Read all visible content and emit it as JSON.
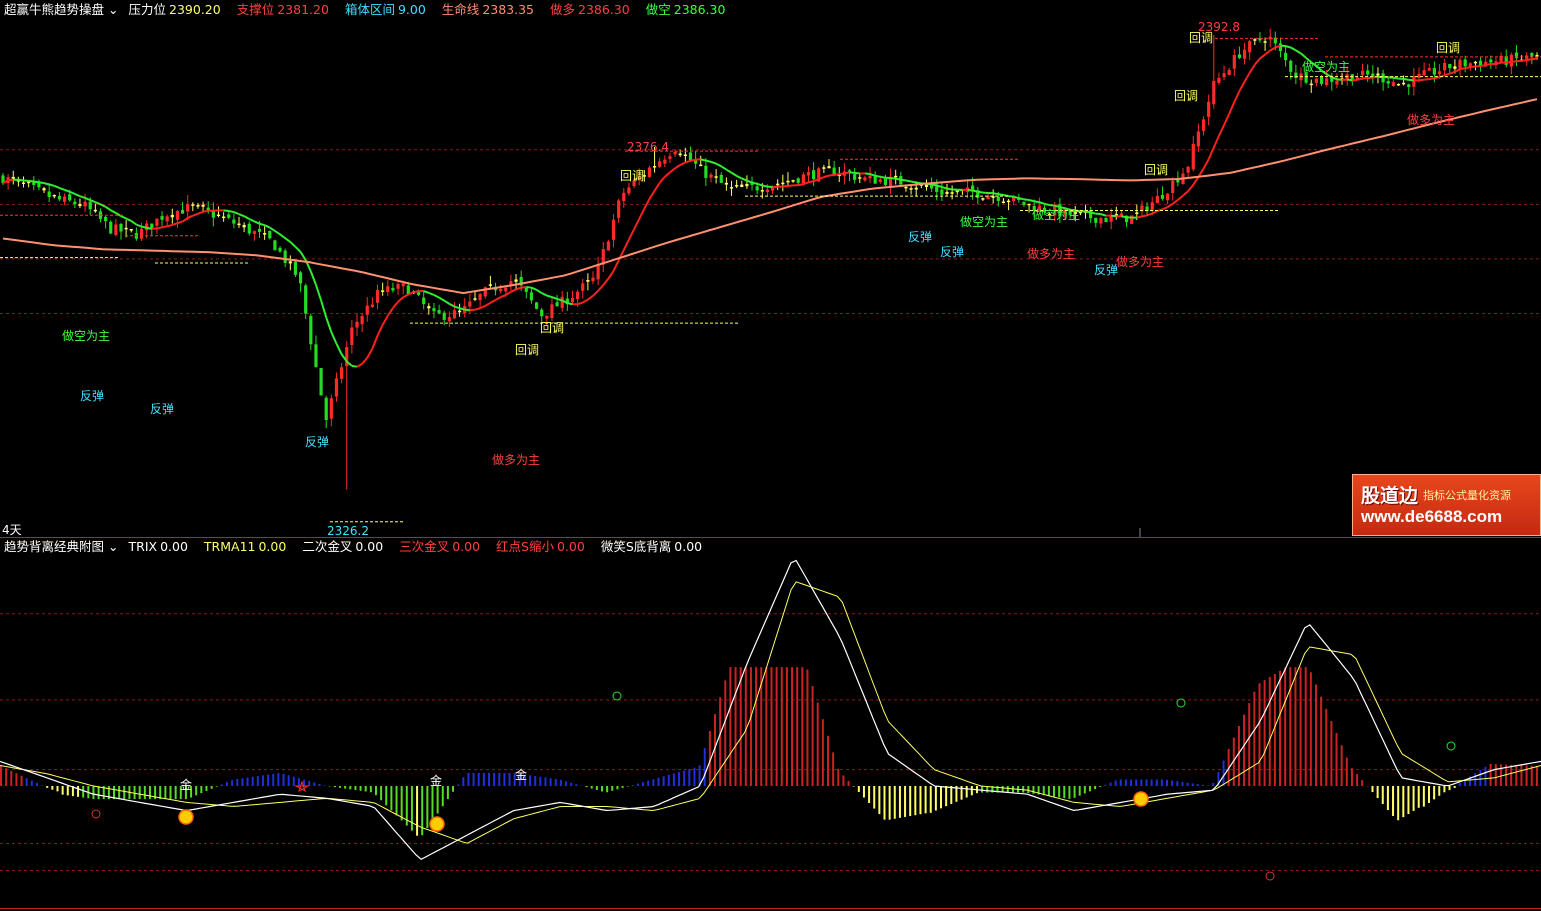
{
  "main_header": {
    "title": "超赢牛熊趋势操盘",
    "items": [
      {
        "label": "压力位",
        "value": "2390.20",
        "color": "#ffffff",
        "vcolor": "#ffff66"
      },
      {
        "label": "支撑位",
        "value": "2381.20",
        "color": "#ff4040",
        "vcolor": "#ff4040"
      },
      {
        "label": "箱体区间",
        "value": "9.00",
        "color": "#40e0ff",
        "vcolor": "#40e0ff"
      },
      {
        "label": "生命线",
        "value": "2383.35",
        "color": "#ff9070",
        "vcolor": "#ff9070"
      },
      {
        "label": "做多",
        "value": "2386.30",
        "color": "#ff4040",
        "vcolor": "#ff4040"
      },
      {
        "label": "做空",
        "value": "2386.30",
        "color": "#40ff40",
        "vcolor": "#40ff40"
      }
    ]
  },
  "sub_header": {
    "title": "趋势背离经典附图",
    "items": [
      {
        "label": "TRIX",
        "value": "0.00",
        "color": "#ffffff"
      },
      {
        "label": "TRMA11",
        "value": "0.00",
        "color": "#ffff66"
      },
      {
        "label": "二次金叉",
        "value": "0.00",
        "color": "#ffffff"
      },
      {
        "label": "三次金叉",
        "value": "0.00",
        "color": "#ff4040"
      },
      {
        "label": "红点S缩小",
        "value": "0.00",
        "color": "#ff4040"
      },
      {
        "label": "微笑S底背离",
        "value": "0.00",
        "color": "#ffffff"
      }
    ]
  },
  "period_label": "4天",
  "price_labels": {
    "high1": "2376.4",
    "high2": "2392.8",
    "low1": "2326.2"
  },
  "annotations": {
    "pullback": "回调",
    "rebound": "反弹",
    "short_main": "做空为主",
    "long_main": "做多为主",
    "gold": "金"
  },
  "watermark": {
    "name": "股道边",
    "tagline": "指标公式量化资源",
    "url": "www.de6688.com"
  },
  "colors": {
    "up": "#ff2a2a",
    "down": "#22dd22",
    "ma_short_up": "#ff2020",
    "ma_short_down": "#30ee30",
    "life_line": "#ff9070",
    "trix": "#ffffff",
    "trma": "#ffff66"
  },
  "chart_data": [
    {
      "type": "line",
      "title": "超赢牛熊趋势操盘",
      "ylim": [
        2320,
        2395
      ],
      "series": [
        {
          "name": "收盘",
          "values": [
            2371.9,
            2370.4,
            2368.7,
            2367.9,
            2364.4,
            2363.6,
            2366.5,
            2367.6,
            2366.3,
            2364.5,
            2362.5,
            2357.1,
            2336.4,
            2350.1,
            2355.2,
            2355.9,
            2351.6,
            2352.1,
            2355.4,
            2357.0,
            2351.8,
            2354.2,
            2357.2,
            2369.5,
            2373.2,
            2376.4,
            2372.8,
            2370.2,
            2370.5,
            2371.3,
            2372.4,
            2372.9,
            2371.7,
            2371.5,
            2370.8,
            2369.7,
            2369.8,
            2369.2,
            2368.0,
            2367.0,
            2366.3,
            2365.9,
            2366.1,
            2369.2,
            2373.4,
            2385.6,
            2390.4,
            2392.8,
            2387.0,
            2386.1,
            2386.8,
            2386.9,
            2385.5,
            2387.2,
            2388.5,
            2388.8,
            2389.1,
            2389.6
          ]
        },
        {
          "name": "生命线",
          "values": [
            2363.0,
            2362.0,
            2361.4,
            2361.2,
            2361.0,
            2360.5,
            2359.5,
            2358.1,
            2356.3,
            2355.0,
            2356.2,
            2357.6,
            2360.0,
            2362.4,
            2364.6,
            2366.8,
            2369.1,
            2370.3,
            2371.0,
            2371.6,
            2371.8,
            2371.7,
            2371.5,
            2371.7,
            2372.6,
            2374.3,
            2376.2,
            2378.0,
            2379.9,
            2381.7,
            2383.4
          ]
        }
      ],
      "markers": {
        "resistance": 2390.2,
        "support": 2381.2
      }
    },
    {
      "type": "line",
      "title": "趋势背离经典附图",
      "series": [
        {
          "name": "TRIX",
          "values": [
            0.3,
            0.1,
            -0.1,
            -0.2,
            -0.3,
            -0.2,
            -0.1,
            -0.15,
            -0.25,
            -0.9,
            -0.6,
            -0.3,
            -0.2,
            -0.3,
            -0.25,
            0.0,
            1.5,
            2.8,
            1.8,
            0.4,
            0.0,
            -0.05,
            -0.1,
            -0.3,
            -0.2,
            -0.1,
            -0.05,
            0.8,
            2.0,
            1.3,
            0.1,
            0.0,
            0.2,
            0.3
          ]
        },
        {
          "name": "TRMA11",
          "values": [
            0.25,
            0.15,
            0.0,
            -0.1,
            -0.2,
            -0.25,
            -0.2,
            -0.15,
            -0.2,
            -0.5,
            -0.7,
            -0.4,
            -0.25,
            -0.25,
            -0.3,
            -0.15,
            0.7,
            2.5,
            2.3,
            0.8,
            0.2,
            0.0,
            -0.05,
            -0.2,
            -0.25,
            -0.15,
            -0.05,
            0.3,
            1.7,
            1.6,
            0.4,
            0.05,
            0.1,
            0.25
          ]
        }
      ]
    }
  ]
}
